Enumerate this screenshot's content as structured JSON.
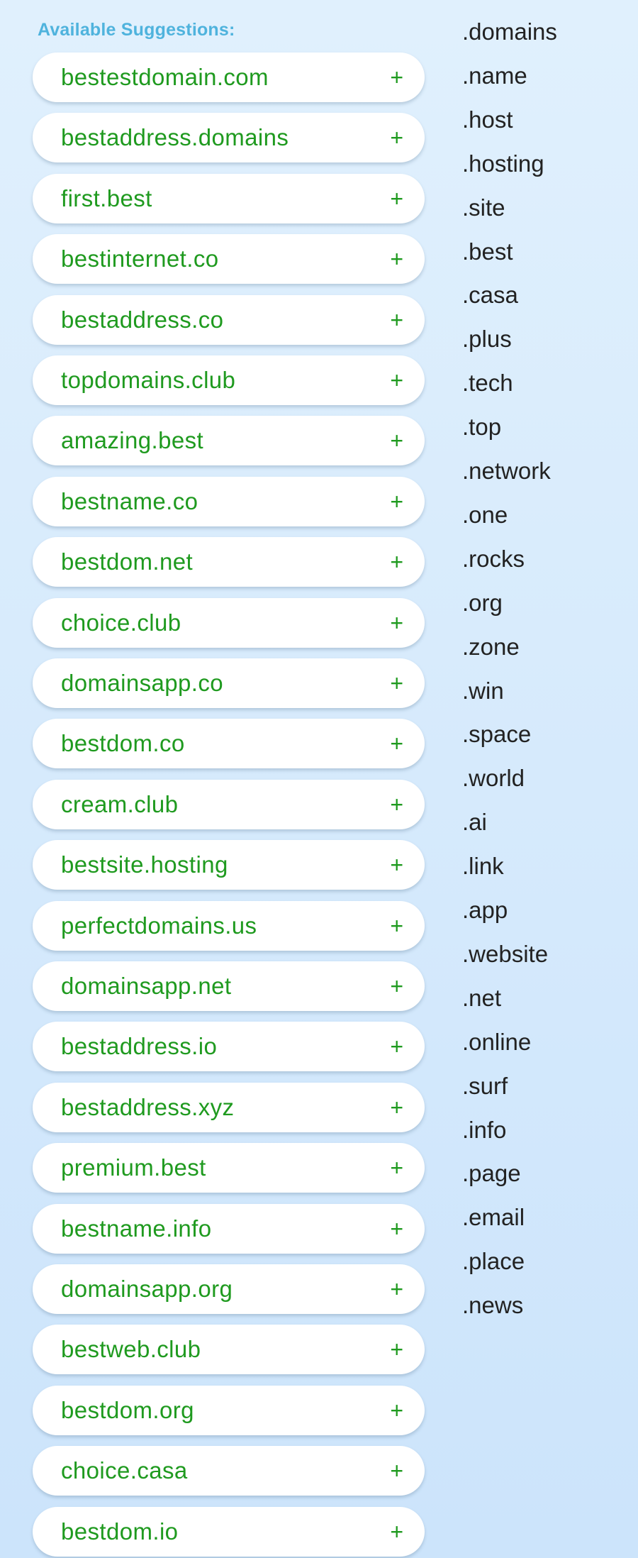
{
  "heading": "Available Suggestions:",
  "add_glyph": "+",
  "suggestions": [
    "bestestdomain.com",
    "bestaddress.domains",
    "first.best",
    "bestinternet.co",
    "bestaddress.co",
    "topdomains.club",
    "amazing.best",
    "bestname.co",
    "bestdom.net",
    "choice.club",
    "domainsapp.co",
    "bestdom.co",
    "cream.club",
    "bestsite.hosting",
    "perfectdomains.us",
    "domainsapp.net",
    "bestaddress.io",
    "bestaddress.xyz",
    "premium.best",
    "bestname.info",
    "domainsapp.org",
    "bestweb.club",
    "bestdom.org",
    "choice.casa",
    "bestdom.io"
  ],
  "tlds": [
    ".domains",
    ".name",
    ".host",
    ".hosting",
    ".site",
    ".best",
    ".casa",
    ".plus",
    ".tech",
    ".top",
    ".network",
    ".one",
    ".rocks",
    ".org",
    ".zone",
    ".win",
    ".space",
    ".world",
    ".ai",
    ".link",
    ".app",
    ".website",
    ".net",
    ".online",
    ".surf",
    ".info",
    ".page",
    ".email",
    ".place",
    ".news"
  ],
  "colors": {
    "suggestion_text": "#1f9a1f",
    "heading": "#4fb3dd",
    "tld_text": "#222222"
  },
  "icons": {
    "add": "plus-icon"
  }
}
